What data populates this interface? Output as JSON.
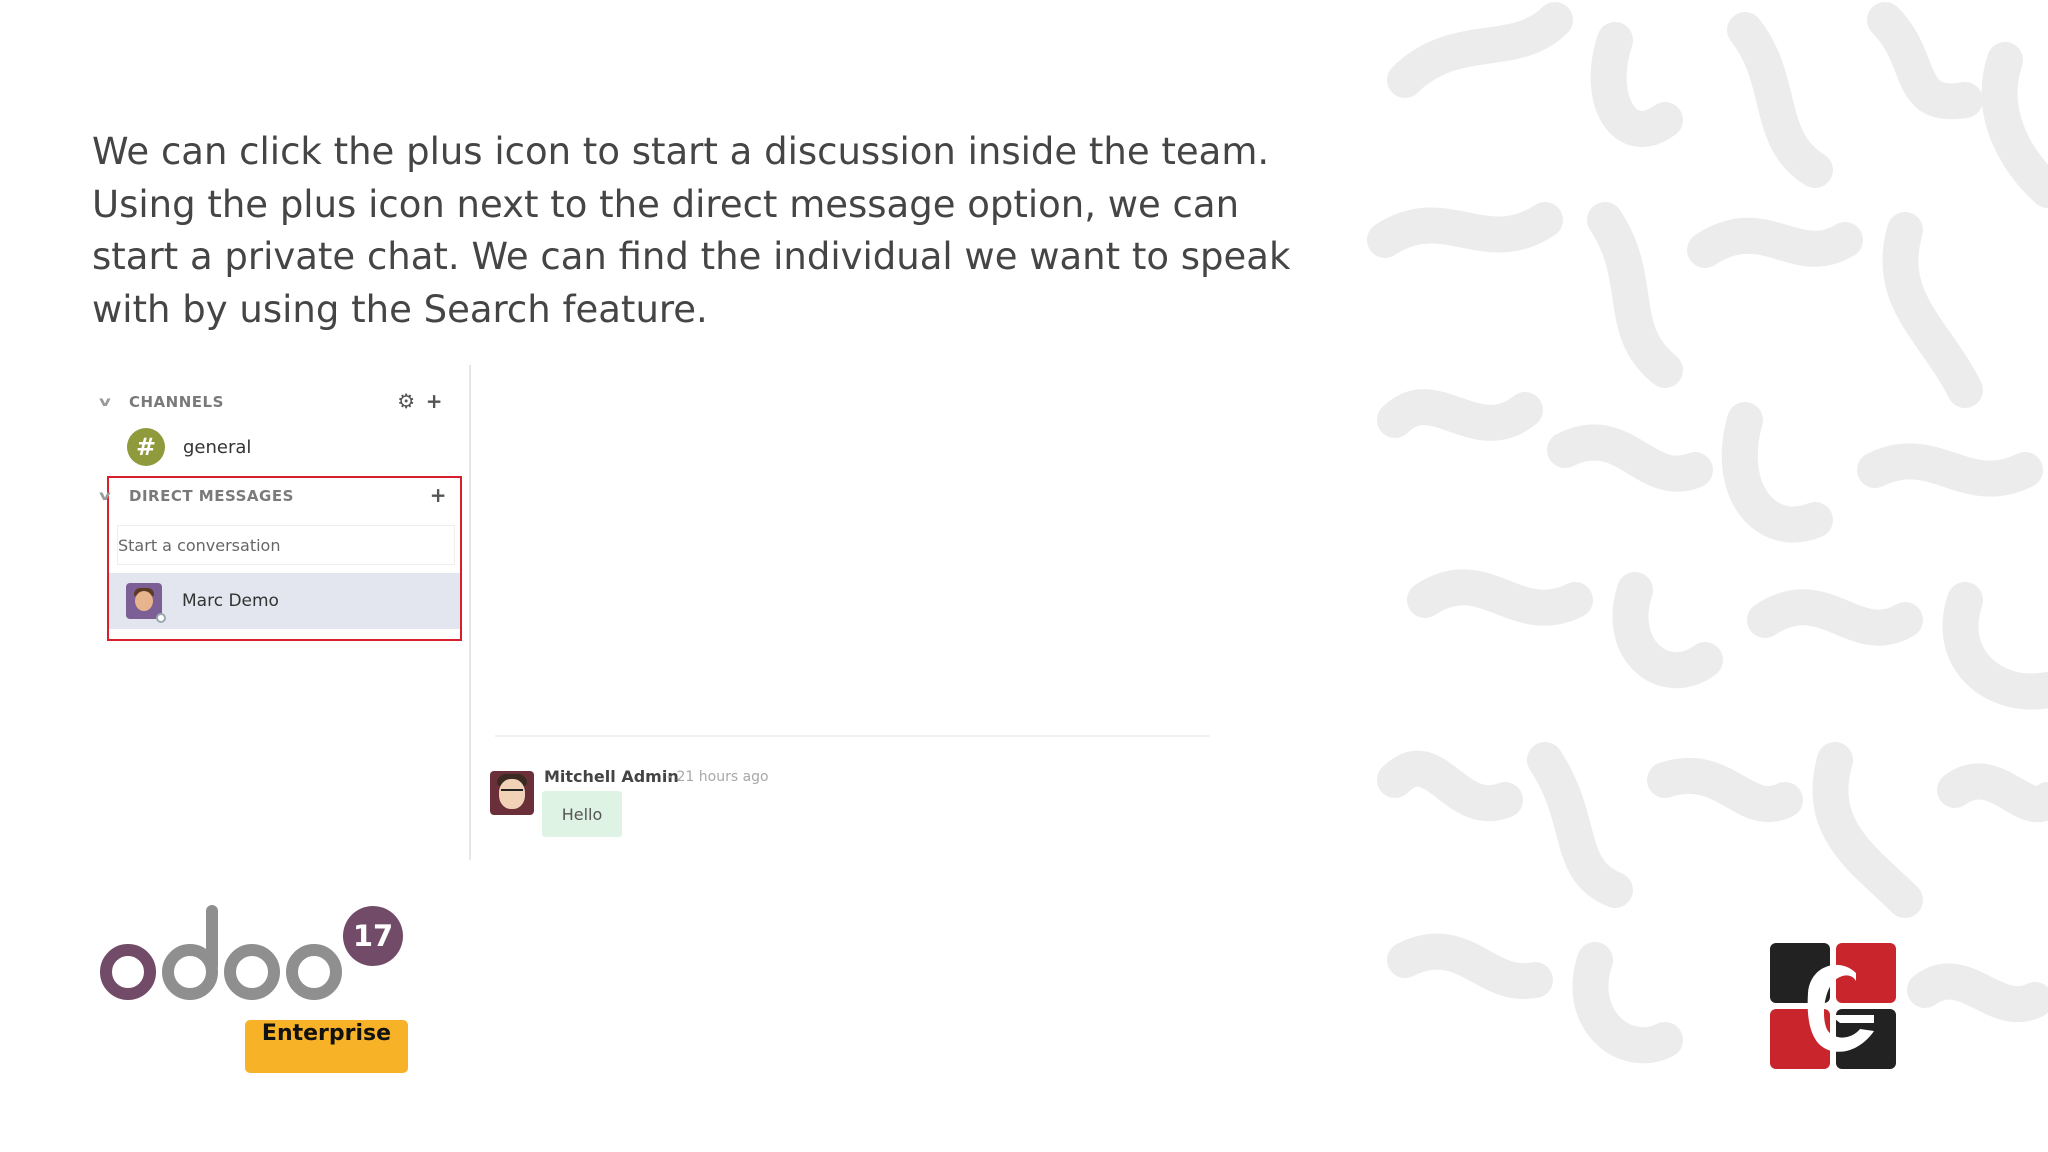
{
  "intro_text": "We can click the plus icon to start a discussion inside the team. Using the plus icon next to the direct message option, we can start a private chat. We can find the individual we want to speak with by using the Search feature.",
  "discuss": {
    "channels_header": "CHANNELS",
    "channels": [
      {
        "name": "general",
        "icon": "hash-icon",
        "badge_color": "#8e9a3c"
      }
    ],
    "direct_messages_header": "DIRECT MESSAGES",
    "search": {
      "placeholder": "Start a conversation",
      "value": ""
    },
    "suggestions": [
      {
        "name": "Marc Demo"
      }
    ],
    "highlight_color": "#d81f2c"
  },
  "message": {
    "author": "Mitchell Admin",
    "time": "- 21 hours ago",
    "body": "Hello"
  },
  "brand": {
    "logo_text": "odoo",
    "version": "17",
    "edition": "Enterprise",
    "odoo_colors": {
      "purple": "#714b67",
      "gray": "#8f8f8f"
    },
    "edition_color": "#f7b228"
  },
  "corner_logo": {
    "name": "company-logo",
    "colors": [
      "#222222",
      "#c8252c",
      "#ffffff"
    ]
  }
}
